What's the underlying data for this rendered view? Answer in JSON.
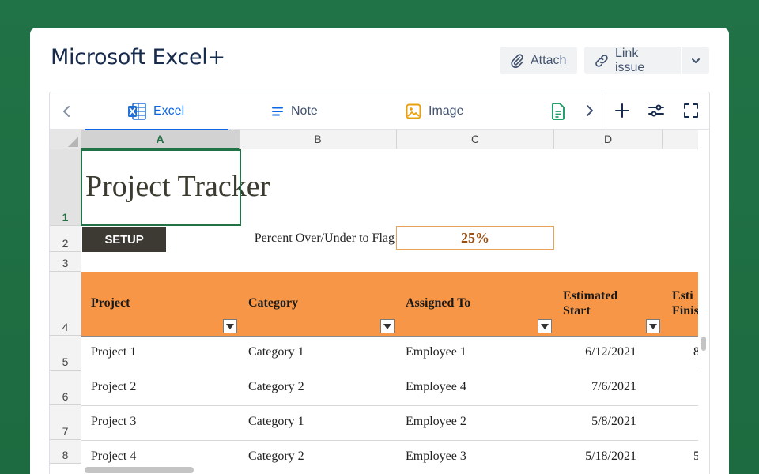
{
  "header": {
    "title": "Microsoft Excel+",
    "attach_label": "Attach",
    "link_issue_label": "Link issue"
  },
  "tabs": [
    {
      "label": "Excel",
      "icon": "excel-icon",
      "active": true
    },
    {
      "label": "Note",
      "icon": "note-icon",
      "active": false
    },
    {
      "label": "Image",
      "icon": "image-icon",
      "active": false
    },
    {
      "label": "",
      "icon": "document-icon",
      "active": false
    }
  ],
  "toolbar": {
    "icons": [
      "chevron-left-icon",
      "chevron-right-icon",
      "plus-icon",
      "sliders-icon",
      "fullscreen-icon"
    ]
  },
  "sheet": {
    "columns": [
      "A",
      "B",
      "C",
      "D"
    ],
    "selected_column": "A",
    "rows": [
      "1",
      "2",
      "3",
      "4",
      "5",
      "6",
      "7",
      "8"
    ],
    "selected_row": "1",
    "title": "Project Tracker",
    "setup_button": "SETUP",
    "flag_label": "Percent Over/Under to Flag",
    "flag_value": "25%",
    "table_headers": [
      "Project",
      "Category",
      "Assigned To",
      "Estimated Start",
      "Estimated Finish"
    ],
    "table_header_lines": {
      "estimated_start": [
        "Estimated",
        "Start"
      ],
      "estimated_finish": [
        "Esti",
        "Finis"
      ]
    },
    "records": [
      {
        "project": "Project 1",
        "category": "Category 1",
        "assigned": "Employee 1",
        "start": "6/12/2021",
        "finish_clip": "8"
      },
      {
        "project": "Project 2",
        "category": "Category 2",
        "assigned": "Employee 4",
        "start": "7/6/2021",
        "finish_clip": ""
      },
      {
        "project": "Project 3",
        "category": "Category 1",
        "assigned": "Employee 2",
        "start": "5/8/2021",
        "finish_clip": ""
      },
      {
        "project": "Project 4",
        "category": "Category 2",
        "assigned": "Employee 3",
        "start": "5/18/2021",
        "finish_clip": "5"
      }
    ]
  },
  "colors": {
    "background": "#207346",
    "excel_green": "#217346",
    "header_orange": "#f79646",
    "tab_active": "#0c66e4",
    "setup_dark": "#3d3a33",
    "flag_value": "#9a4e10"
  }
}
